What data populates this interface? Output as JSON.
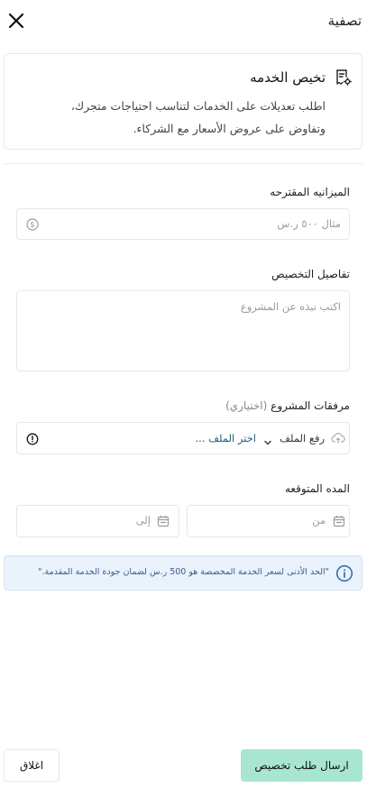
{
  "header": {
    "title": "تصفية"
  },
  "card": {
    "title": "تخيص الخدمه",
    "description_line1": "اطلب تعديلات على الخدمات لتناسب احتياجات متجرك،",
    "description_line2": "وتفاوض على عروض الأسعار مع الشركاء."
  },
  "form": {
    "budget": {
      "label": "الميزانيه المقترحه",
      "placeholder": "مثال ٥٠٠ ر.س"
    },
    "details": {
      "label": "تفاصيل التخصيص",
      "placeholder": "اكتب نبذه عن المشروع"
    },
    "attachments": {
      "label": "مرفقات المشروع",
      "optional": "(اختياري)",
      "upload_label": "رفع الملف",
      "choose_label": "اختر الملف ..."
    },
    "duration": {
      "label": "المده المتوقعه",
      "from_placeholder": "من",
      "to_placeholder": "إلى"
    }
  },
  "notice": {
    "text": "\"الحد الأدنى لسعر الخدمة المخصصة هو 500 ر.س لضمان جودة الخدمة المقدمة.\""
  },
  "footer": {
    "submit_label": "ارسال طلب تخصيص",
    "close_label": "اغلاق"
  },
  "colors": {
    "submit_bg": "#a8e6cf",
    "notice_bg": "#eaf2fb",
    "notice_text": "#3a5f8e"
  }
}
